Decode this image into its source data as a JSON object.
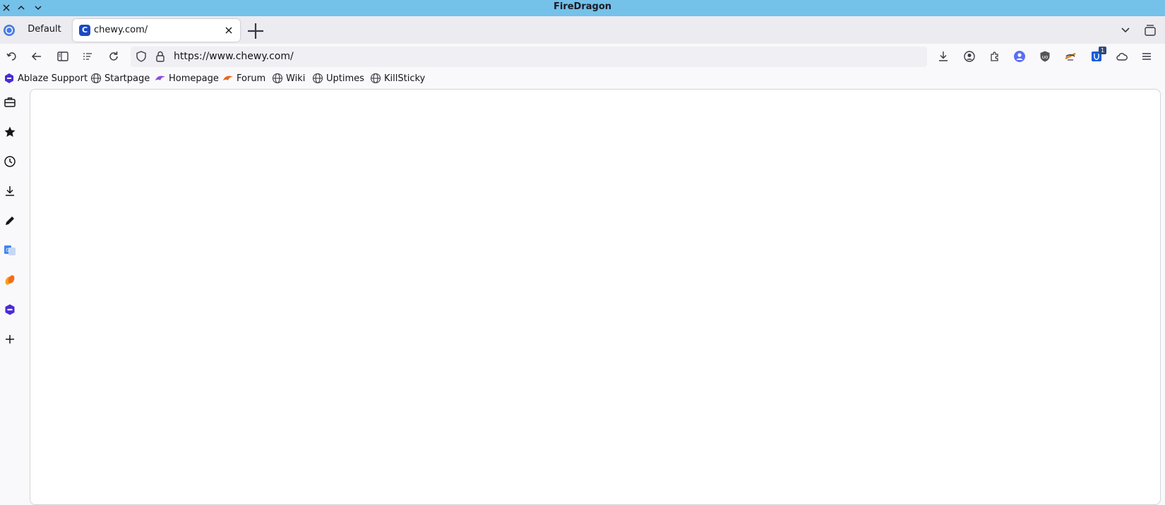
{
  "window": {
    "title": "FireDragon"
  },
  "tabs": {
    "profile_label": "Default",
    "active_tab": {
      "title": "chewy.com/",
      "favicon_letter": "C"
    }
  },
  "navbar": {
    "url": "https://www.chewy.com/"
  },
  "bookmarks": [
    {
      "label": "Ablaze Support",
      "icon": "ablaze-icon"
    },
    {
      "label": "Startpage",
      "icon": "globe-icon"
    },
    {
      "label": "Homepage",
      "icon": "dragon-icon"
    },
    {
      "label": "Forum",
      "icon": "dragon-orange-icon"
    },
    {
      "label": "Wiki",
      "icon": "globe-icon"
    },
    {
      "label": "Uptimes",
      "icon": "globe-icon"
    },
    {
      "label": "KillSticky",
      "icon": "globe-icon"
    }
  ],
  "extensions": {
    "badge_count": "1"
  },
  "colors": {
    "titlebar": "#74c1ea",
    "accent": "#1c49c2"
  }
}
